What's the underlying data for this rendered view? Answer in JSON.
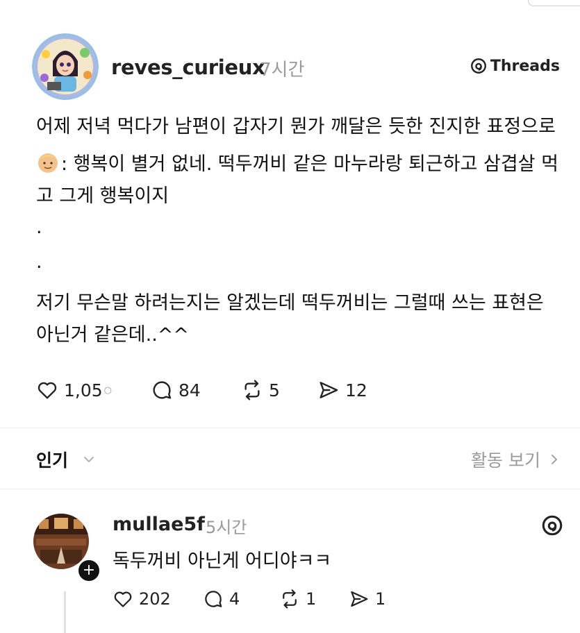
{
  "post": {
    "username": "reves_curieux",
    "time": "7시간",
    "brand": "Threads",
    "lines": [
      "어제 저녁 먹다가 남편이 갑자기 뭔가 깨달은 듯한 진지한 표정으로",
      ": 행복이 별거 없네. 떡두꺼비 같은 마누라랑 퇴근하고 삼겹살 먹고 그게 행복이지",
      ".",
      ".",
      "저기 무슨말 하려는지는 알겠는데 떡두꺼비는 그럴때 쓰는 표현은 아닌거 같은데..^^"
    ],
    "stats": {
      "likes": "1,05",
      "likes_suffix": "○",
      "replies": "84",
      "reposts": "5",
      "shares": "12"
    }
  },
  "sort": {
    "label": "인기",
    "activity": "활동 보기"
  },
  "comment": {
    "username": "mullae5f",
    "time": "5시간",
    "text": "독두꺼비 아닌게 어디야ㅋㅋ",
    "follow": "+",
    "stats": {
      "likes": "202",
      "replies": "4",
      "reposts": "1",
      "shares": "1"
    }
  },
  "icons": [
    "heart-icon",
    "reply-icon",
    "repost-icon",
    "share-icon",
    "threads-logo-icon",
    "chevron-down-icon",
    "chevron-right-icon"
  ]
}
